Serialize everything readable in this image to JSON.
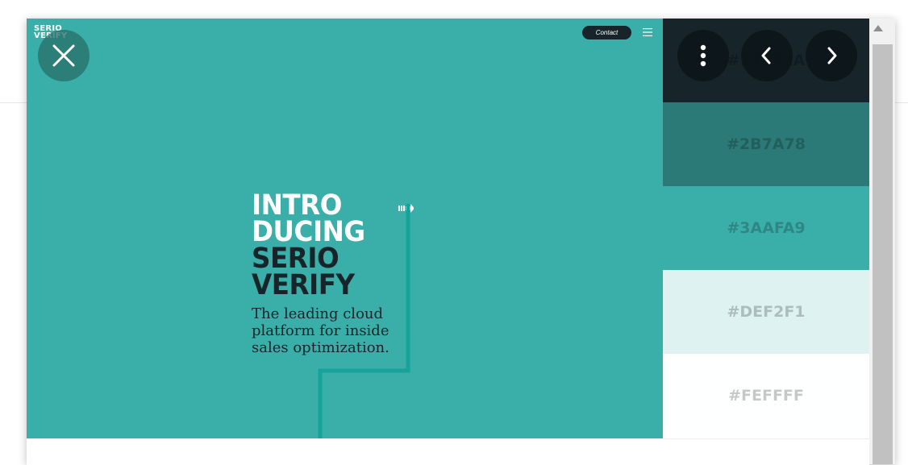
{
  "site": {
    "logo_line1": "SERIO",
    "logo_line2": "VERIFY",
    "contact_label": "Contact",
    "headline": [
      "INTRO",
      "DUCING",
      "SERIO",
      "VERIFY"
    ],
    "tagline": [
      "The leading cloud",
      "platform for inside",
      "sales optimization."
    ]
  },
  "palette": [
    {
      "hex": "#17252A",
      "color": "#17252a"
    },
    {
      "hex": "#2B7A78",
      "color": "#2b7a78"
    },
    {
      "hex": "#3AAFA9",
      "color": "#3aafa9"
    },
    {
      "hex": "#DEF2F1",
      "color": "#def2f1"
    },
    {
      "hex": "#FEFFFF",
      "color": "#feffff"
    }
  ],
  "icons": {
    "close": "close-icon",
    "more": "more-vertical-icon",
    "prev": "chevron-left-icon",
    "next": "chevron-right-icon",
    "menu": "hamburger-icon",
    "scroll_up": "scroll-up-arrow-icon"
  }
}
